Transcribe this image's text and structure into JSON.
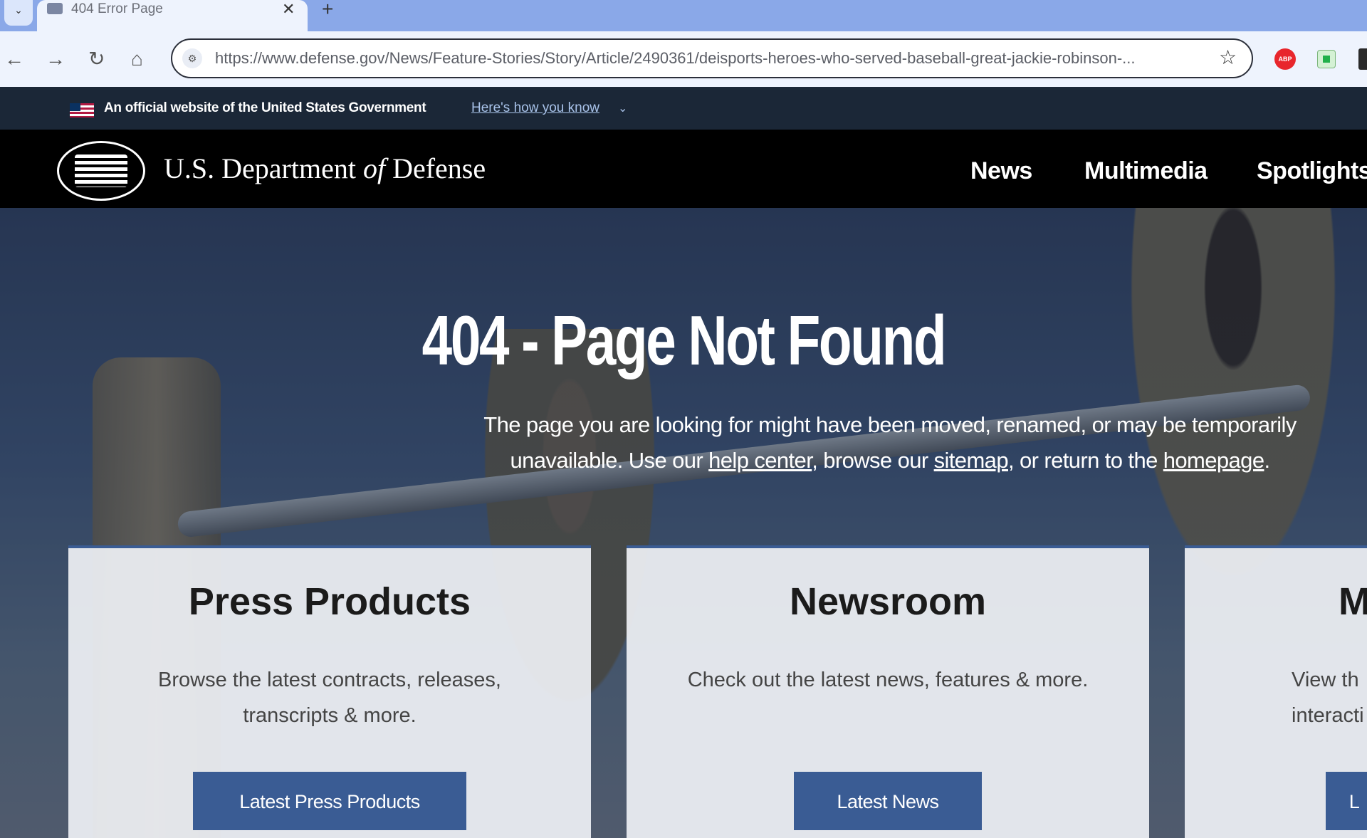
{
  "browser": {
    "tab_title": "404 Error Page",
    "url": "https://www.defense.gov/News/Feature-Stories/Story/Article/2490361/deisports-heroes-who-served-baseball-great-jackie-robinson-...",
    "extension_label": "ABP"
  },
  "gov_banner": {
    "text": "An official website of the United States Government",
    "link": "Here's how you know"
  },
  "header": {
    "site_title_prefix": "U.S. Department",
    "site_title_of": "of",
    "site_title_suffix": "Defense",
    "nav": [
      "News",
      "Multimedia",
      "Spotlights"
    ]
  },
  "hero": {
    "title": "404 - Page Not Found",
    "text_1": "The page you are looking for might have been moved, renamed, or may be temporarily unavailable. Use our ",
    "link_help": "help center",
    "text_2": ", browse our ",
    "link_sitemap": "sitemap",
    "text_3": ", or return to the ",
    "link_home": "homepage",
    "text_4": "."
  },
  "cards": [
    {
      "title": "Press Products",
      "desc": "Browse the latest contracts, releases, transcripts & more.",
      "button": "Latest Press Products"
    },
    {
      "title": "Newsroom",
      "desc": "Check out the latest news, features & more.",
      "button": "Latest News"
    },
    {
      "title": "M",
      "desc_1": "View th",
      "desc_2": "interacti",
      "button": "L"
    }
  ],
  "colors": {
    "accent": "#3a5c94",
    "gov_banner": "#1b2737",
    "header": "#000000"
  }
}
